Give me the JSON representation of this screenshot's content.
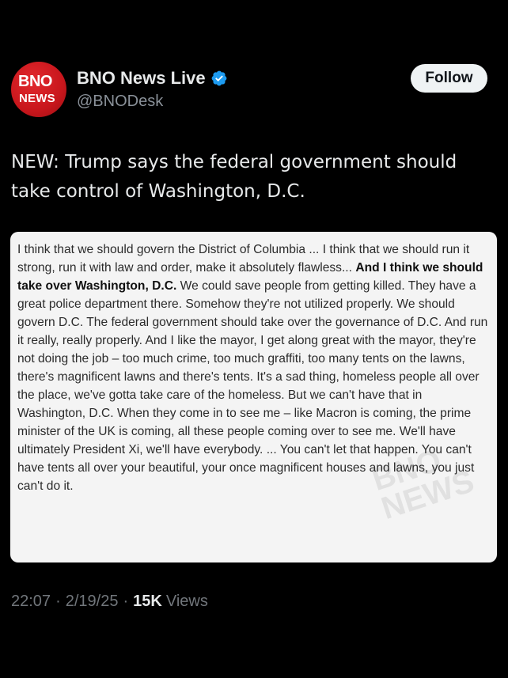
{
  "account": {
    "avatar_text_top": "BNO",
    "avatar_text_bottom": "NEWS",
    "display_name": "BNO News Live",
    "handle": "@BNODesk",
    "follow_label": "Follow"
  },
  "tweet": {
    "text": "NEW: Trump says the federal government should take control of Washington, D.C."
  },
  "quote_card": {
    "part1": "I think that we should govern the District of Columbia ... I think that we should run it strong, run it with law and order, make it absolutely flawless...",
    "bold": "And I think we should take over Washington, D.C.",
    "part2": "We could save people from getting killed. They have a great police department there. Somehow they're not utilized properly. We should govern D.C. The federal government should take over the governance of D.C. And run it really, really properly. And I like the mayor, I get along great with the mayor, they're not doing the job – too much crime, too much graffiti, too many tents on the lawns, there's magnificent lawns and there's tents. It's a sad thing, homeless people all over the place, we've gotta take care of the homeless. But we can't have that in Washington, D.C. When they come in to see me – like Macron is coming, the prime minister of the UK is coming, all these people coming over to see me. We'll have ultimately President Xi, we'll have everybody. ... You can't let that happen. You can't have tents all over your beautiful, your once magnificent houses and lawns, you just can't do it.",
    "watermark_top": "BNO",
    "watermark_bottom": "NEWS"
  },
  "meta": {
    "time": "22:07",
    "separator": "·",
    "date": "2/19/25",
    "views_count": "15K",
    "views_label": "Views"
  },
  "colors": {
    "background": "#000000",
    "avatar_red": "#c8161c",
    "verified_blue": "#1d9bf0",
    "card_background": "#f4f4f4"
  },
  "icons": {
    "verified": "verified-badge-icon"
  }
}
